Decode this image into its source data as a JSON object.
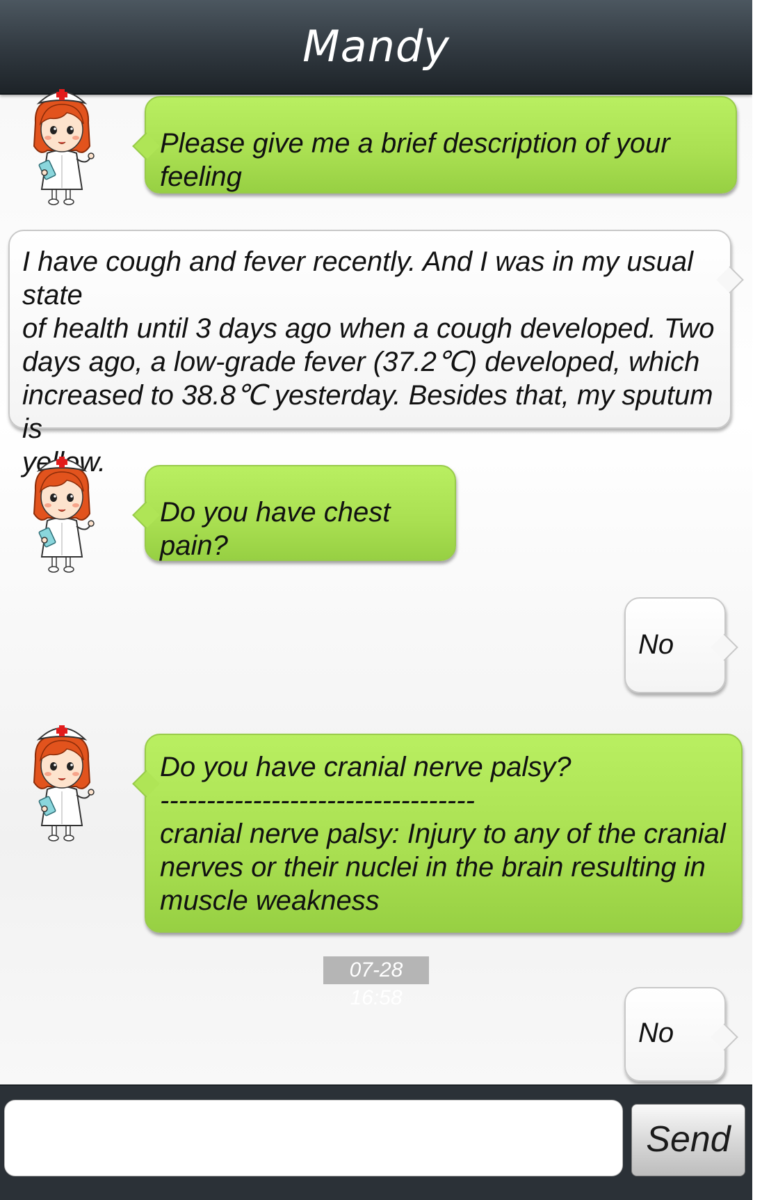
{
  "header": {
    "title": "Mandy"
  },
  "messages": [
    {
      "sender": "bot",
      "avatar_icon": "nurse-avatar-icon",
      "text": "Please give me a brief description of your feeling"
    },
    {
      "sender": "user",
      "text": "I have cough and fever recently. And I was in my usual state\nof health until 3 days ago when a cough developed. Two\ndays ago, a low-grade fever (37.2℃) developed, which\nincreased to 38.8℃ yesterday. Besides that, my sputum is\nyellow."
    },
    {
      "sender": "bot",
      "avatar_icon": "nurse-avatar-icon",
      "text": "Do you have chest pain?"
    },
    {
      "sender": "user",
      "text": "No"
    },
    {
      "sender": "bot",
      "avatar_icon": "nurse-avatar-icon",
      "text": "Do you have cranial nerve palsy?\n----------------------------------\ncranial nerve palsy: Injury to any of the cranial\nnerves or their nuclei in the brain resulting in\nmuscle weakness"
    },
    {
      "sender": "user",
      "text": "No"
    }
  ],
  "timestamp": "07-28 16:58",
  "composer": {
    "input_value": "",
    "send_label": "Send"
  },
  "colors": {
    "header": "#30383f",
    "bot_bubble": "#a9df51",
    "user_bubble": "#f4f4f4",
    "timestamp_bg": "#b5b5b5",
    "composer_bg": "#2b3137"
  }
}
